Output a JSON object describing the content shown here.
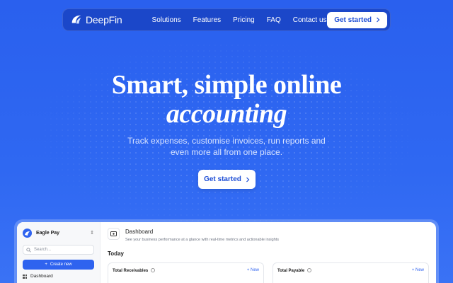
{
  "brand": {
    "name": "DeepFin"
  },
  "nav": {
    "items": [
      "Solutions",
      "Features",
      "Pricing",
      "FAQ",
      "Contact us"
    ],
    "cta": "Get started"
  },
  "hero": {
    "title_line1": "Smart, simple online",
    "title_line2": "accounting",
    "subtitle_line1": "Track expenses, customise invoices, run reports and",
    "subtitle_line2": "even more all from one place.",
    "cta": "Get started"
  },
  "app": {
    "org_name": "Eagle Pay",
    "search_placeholder": "Search...",
    "create_label": "Create new",
    "sidebar": [
      {
        "label": "Dashboard",
        "icon": "grid-icon"
      }
    ],
    "header": {
      "title": "Dashboard",
      "subtitle": "See your business performance at a glance with real-time metrics and actionable insights"
    },
    "section": "Today",
    "cards": [
      {
        "title": "Total Receivables",
        "action": "New"
      },
      {
        "title": "Total Payable",
        "action": "New"
      }
    ]
  },
  "colors": {
    "background": "#2b63f0",
    "nav": "#1b47c9",
    "accent": "#2f63ef"
  }
}
